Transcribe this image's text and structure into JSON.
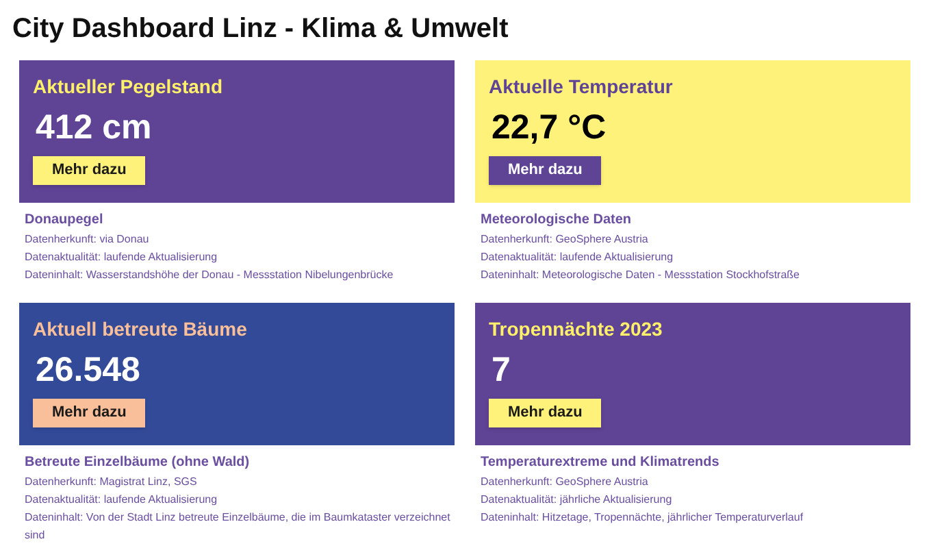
{
  "title": "City Dashboard Linz - Klima & Umwelt",
  "cards": [
    {
      "kind": "purple",
      "heading": "Aktueller Pegelstand",
      "value": "412 cm",
      "button": "Mehr dazu",
      "info_title": "Donaupegel",
      "info_lines": [
        "Datenherkunft: via Donau",
        "Datenaktualität: laufende Aktualisierung",
        "Dateninhalt: Wasserstandshöhe der Donau - Messstation Nibelungenbrücke"
      ]
    },
    {
      "kind": "yellow",
      "heading": "Aktuelle Temperatur",
      "value": "22,7 °C",
      "button": "Mehr dazu",
      "info_title": "Meteorologische Daten",
      "info_lines": [
        "Datenherkunft: GeoSphere Austria",
        "Datenaktualität: laufende Aktualisierung",
        "Dateninhalt: Meteorologische Daten - Messstation Stockhofstraße"
      ]
    },
    {
      "kind": "blue",
      "heading": "Aktuell betreute Bäume",
      "value": "26.548",
      "button": "Mehr dazu",
      "info_title": "Betreute Einzelbäume (ohne Wald)",
      "info_lines": [
        "Datenherkunft: Magistrat Linz, SGS",
        "Datenaktualität: laufende Aktualisierung",
        "Dateninhalt: Von der Stadt Linz betreute Einzelbäume, die im Baumkataster verzeichnet sind"
      ]
    },
    {
      "kind": "purple",
      "heading": "Tropennächte 2023",
      "value": "7",
      "button": "Mehr dazu",
      "info_title": "Temperaturextreme und Klimatrends",
      "info_lines": [
        "Datenherkunft: GeoSphere Austria",
        "Datenaktualität: jährliche Aktualisierung",
        "Dateninhalt: Hitzetage, Tropennächte, jährlicher Temperaturverlauf"
      ]
    }
  ]
}
